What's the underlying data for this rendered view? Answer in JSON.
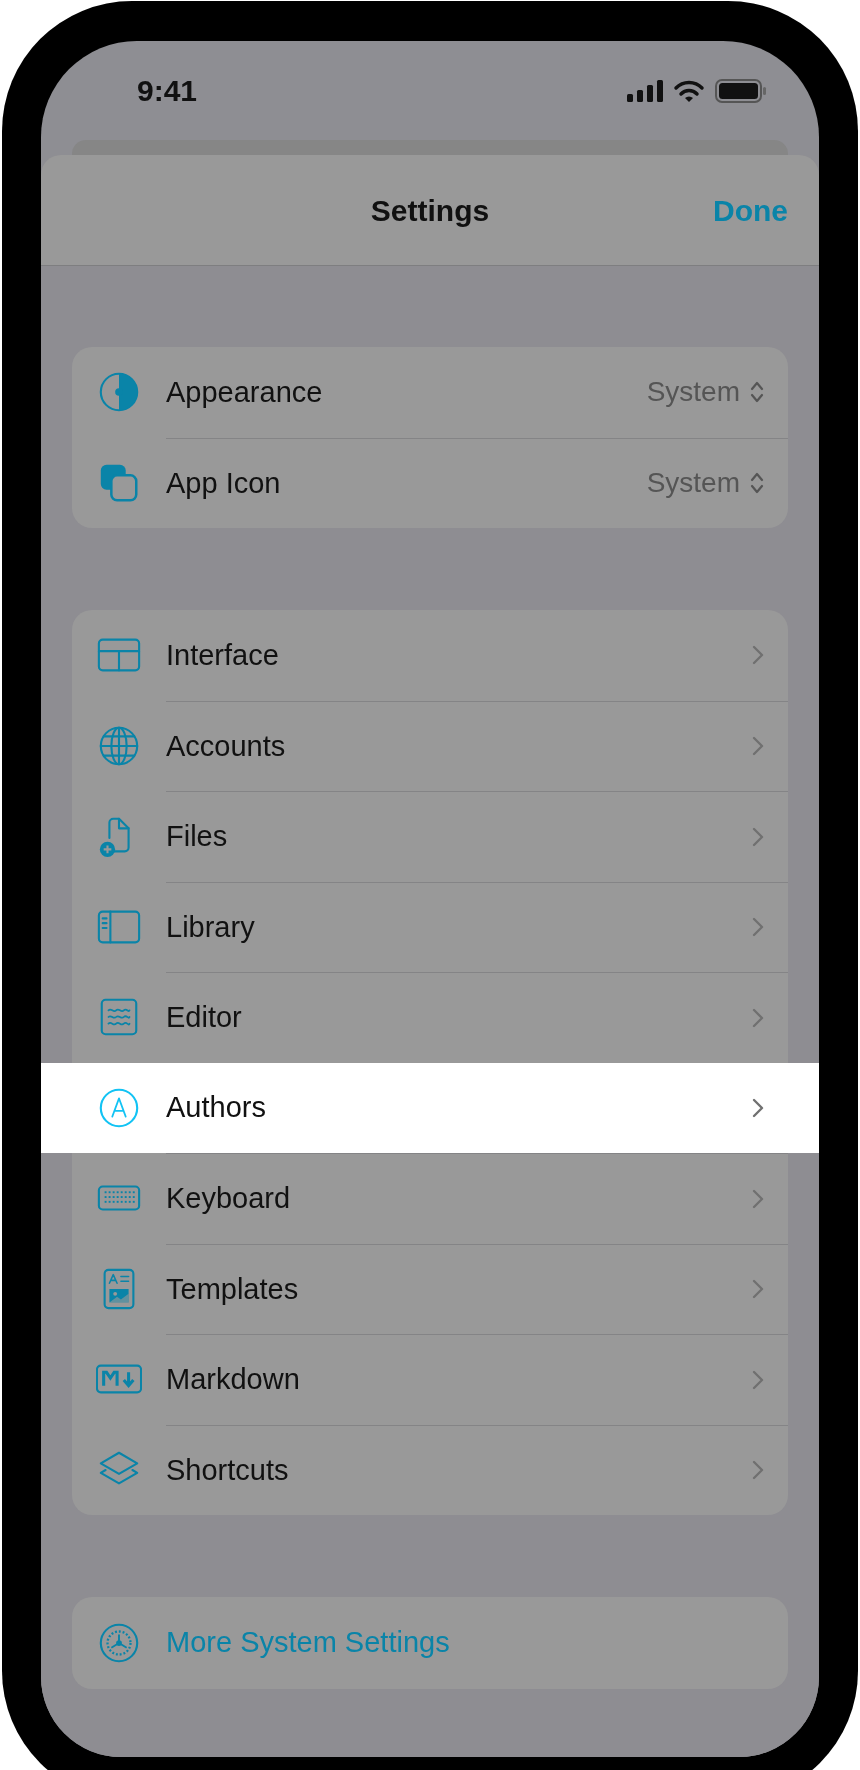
{
  "status_bar": {
    "time": "9:41"
  },
  "header": {
    "title": "Settings",
    "done": "Done"
  },
  "groups": [
    {
      "rows": [
        {
          "label": "Appearance",
          "value": "System",
          "selected": false
        },
        {
          "label": "App Icon",
          "value": "System",
          "selected": false
        }
      ]
    },
    {
      "rows": [
        {
          "label": "Interface",
          "selected": false
        },
        {
          "label": "Accounts",
          "selected": false
        },
        {
          "label": "Files",
          "selected": false
        },
        {
          "label": "Library",
          "selected": false
        },
        {
          "label": "Editor",
          "selected": false
        },
        {
          "label": "Authors",
          "selected": true
        },
        {
          "label": "Keyboard",
          "selected": false
        },
        {
          "label": "Templates",
          "selected": false
        },
        {
          "label": "Markdown",
          "selected": false
        },
        {
          "label": "Shortcuts",
          "selected": false
        }
      ]
    }
  ],
  "footer_link": {
    "label": "More System Settings"
  }
}
